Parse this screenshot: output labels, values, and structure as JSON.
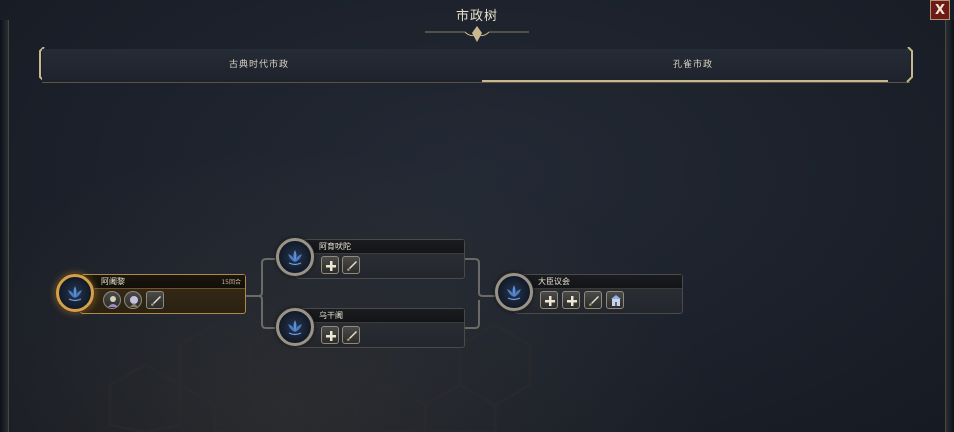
{
  "window": {
    "title": "市政树",
    "close_label": "X"
  },
  "tabs": [
    {
      "label": "古典时代市政",
      "selected": false
    },
    {
      "label": "孔雀市政",
      "selected": true
    }
  ],
  "nodes": {
    "node1": {
      "name": "阿阇黎",
      "turns": "15回合",
      "state": "researching",
      "unlocks": [
        "governor-icon",
        "scholar-icon",
        "sword-icon"
      ]
    },
    "node2": {
      "name": "阿育吠陀",
      "unlocks": [
        "plus-icon",
        "sword-icon"
      ]
    },
    "node3": {
      "name": "乌干阇",
      "unlocks": [
        "plus-icon",
        "sword-icon"
      ]
    },
    "node4": {
      "name": "大臣议会",
      "unlocks": [
        "plus-icon",
        "plus-icon",
        "sword-icon",
        "building-icon"
      ]
    }
  },
  "colors": {
    "accent_gold": "#c9b88e",
    "active_border": "#d4a14a",
    "close_red": "#6e1a1a"
  }
}
